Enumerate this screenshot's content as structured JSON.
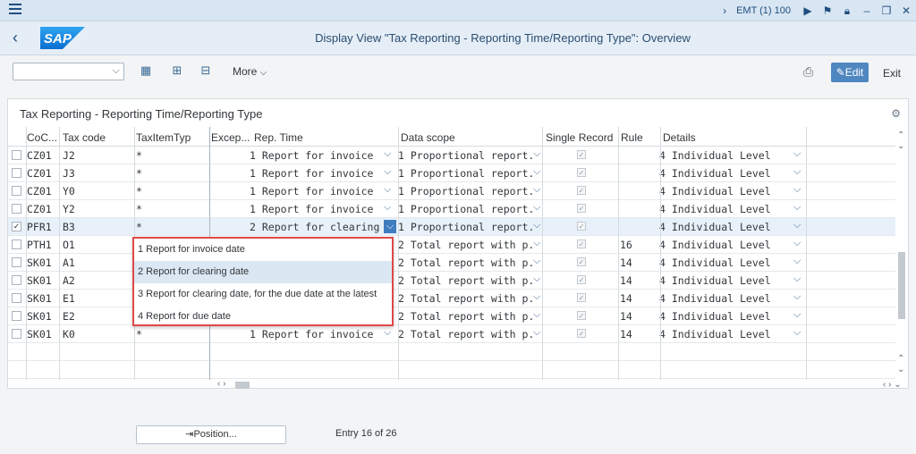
{
  "system": {
    "label": "EMT (1) 100"
  },
  "header": {
    "title": "Display View \"Tax Reporting - Reporting Time/Reporting Type\": Overview",
    "logo_text": "SAP"
  },
  "toolbar": {
    "more_label": "More",
    "edit_label": "Edit",
    "exit_label": "Exit"
  },
  "panel": {
    "title": "Tax Reporting - Reporting Time/Reporting Type"
  },
  "columns": [
    "CoC...",
    "Tax code",
    "TaxItemTyp",
    "Excep...",
    "Rep. Time",
    "Data scope",
    "Single Record",
    "Rule",
    "Details"
  ],
  "rows": [
    {
      "coc": "CZ01",
      "tax": "J2",
      "item": "*",
      "rep": "1 Report for invoice",
      "scope": "1 Proportional report.",
      "rule": "",
      "details": "4 Individual Level",
      "selected": false
    },
    {
      "coc": "CZ01",
      "tax": "J3",
      "item": "*",
      "rep": "1 Report for invoice",
      "scope": "1 Proportional report.",
      "rule": "",
      "details": "4 Individual Level",
      "selected": false
    },
    {
      "coc": "CZ01",
      "tax": "Y0",
      "item": "*",
      "rep": "1 Report for invoice",
      "scope": "1 Proportional report.",
      "rule": "",
      "details": "4 Individual Level",
      "selected": false
    },
    {
      "coc": "CZ01",
      "tax": "Y2",
      "item": "*",
      "rep": "1 Report for invoice",
      "scope": "1 Proportional report.",
      "rule": "",
      "details": "4 Individual Level",
      "selected": false
    },
    {
      "coc": "PFR1",
      "tax": "B3",
      "item": "*",
      "rep": "2 Report for clearing",
      "scope": "1 Proportional report.",
      "rule": "",
      "details": "4 Individual Level",
      "selected": true
    },
    {
      "coc": "PTH1",
      "tax": "O1",
      "item": "",
      "rep": "",
      "scope": "2 Total report with p.",
      "rule": "16",
      "details": "4 Individual Level",
      "selected": false
    },
    {
      "coc": "SK01",
      "tax": "A1",
      "item": "",
      "rep": "",
      "scope": "2 Total report with p.",
      "rule": "14",
      "details": "4 Individual Level",
      "selected": false
    },
    {
      "coc": "SK01",
      "tax": "A2",
      "item": "",
      "rep": "",
      "scope": "2 Total report with p.",
      "rule": "14",
      "details": "4 Individual Level",
      "selected": false
    },
    {
      "coc": "SK01",
      "tax": "E1",
      "item": "",
      "rep": "",
      "scope": "2 Total report with p.",
      "rule": "14",
      "details": "4 Individual Level",
      "selected": false
    },
    {
      "coc": "SK01",
      "tax": "E2",
      "item": "",
      "rep": "",
      "scope": "2 Total report with p.",
      "rule": "14",
      "details": "4 Individual Level",
      "selected": false
    },
    {
      "coc": "SK01",
      "tax": "K0",
      "item": "*",
      "rep": "1 Report for invoice",
      "scope": "2 Total report with p.",
      "rule": "14",
      "details": "4 Individual Level",
      "selected": false
    }
  ],
  "popup": {
    "options": [
      "1 Report for invoice date",
      "2 Report for clearing date",
      "3 Report for clearing date, for the due date at the latest",
      "4 Report for due date"
    ]
  },
  "footer": {
    "position_label": "Position...",
    "entry_text": "Entry 16 of 26"
  }
}
